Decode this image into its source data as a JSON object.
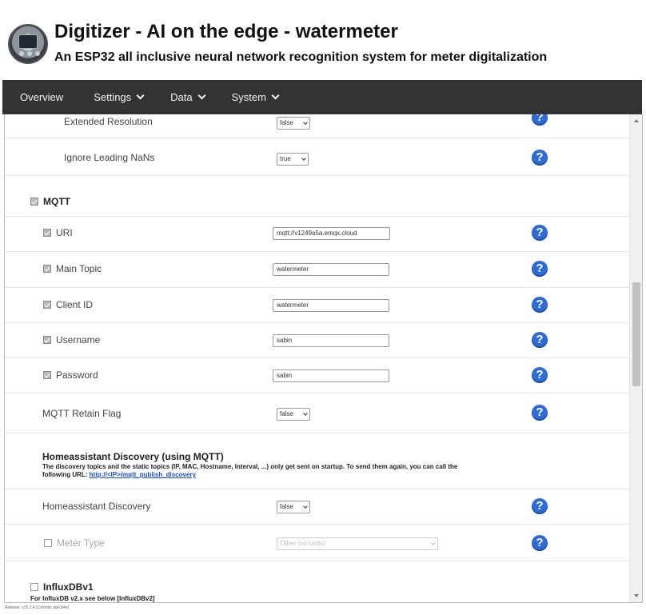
{
  "header": {
    "title": "Digitizer - AI on the edge - watermeter",
    "subtitle": "An ESP32 all inclusive neural network recognition system for meter digitalization"
  },
  "nav": {
    "overview": "Overview",
    "settings": "Settings",
    "data": "Data",
    "system": "System"
  },
  "rows": {
    "extended_resolution": {
      "label": "Extended Resolution",
      "value": "false"
    },
    "ignore_leading_nans": {
      "label": "Ignore Leading NaNs",
      "value": "true"
    }
  },
  "mqtt": {
    "section_label": "MQTT",
    "uri": {
      "label": "URI",
      "value": "mqtt://v1249a5a.emqx.cloud"
    },
    "main_topic": {
      "label": "Main Topic",
      "value": "watermeter"
    },
    "client_id": {
      "label": "Client ID",
      "value": "watermeter"
    },
    "username": {
      "label": "Username",
      "value": "sabin"
    },
    "password": {
      "label": "Password",
      "value": "sabin"
    },
    "retain_flag": {
      "label": "MQTT Retain Flag",
      "value": "false"
    }
  },
  "homeassistant": {
    "title": "Homeassistant Discovery (using MQTT)",
    "desc_line1": "The discovery topics and the static topics (IP, MAC, Hostname, Interval, ...) only get sent on startup. To send them again, you can call the",
    "desc_line2_prefix": "following URL: ",
    "desc_link": "http://<IP>/mqtt_publish_discovery",
    "discovery": {
      "label": "Homeassistant Discovery",
      "value": "false"
    },
    "meter_type": {
      "label": "Meter Type",
      "value": "Other (no Units)"
    }
  },
  "influx": {
    "section_label": "InfluxDBv1",
    "note": "For InfluxDB v2.x see below [InfluxDBv2]"
  },
  "footer": {
    "text": "Release: v15.2.4 (Commit: abe1f4e)"
  },
  "help_symbol": "?",
  "colors": {
    "navbar": "#333333",
    "help_icon": "#2e6bd6",
    "link": "#1a4ed8"
  }
}
